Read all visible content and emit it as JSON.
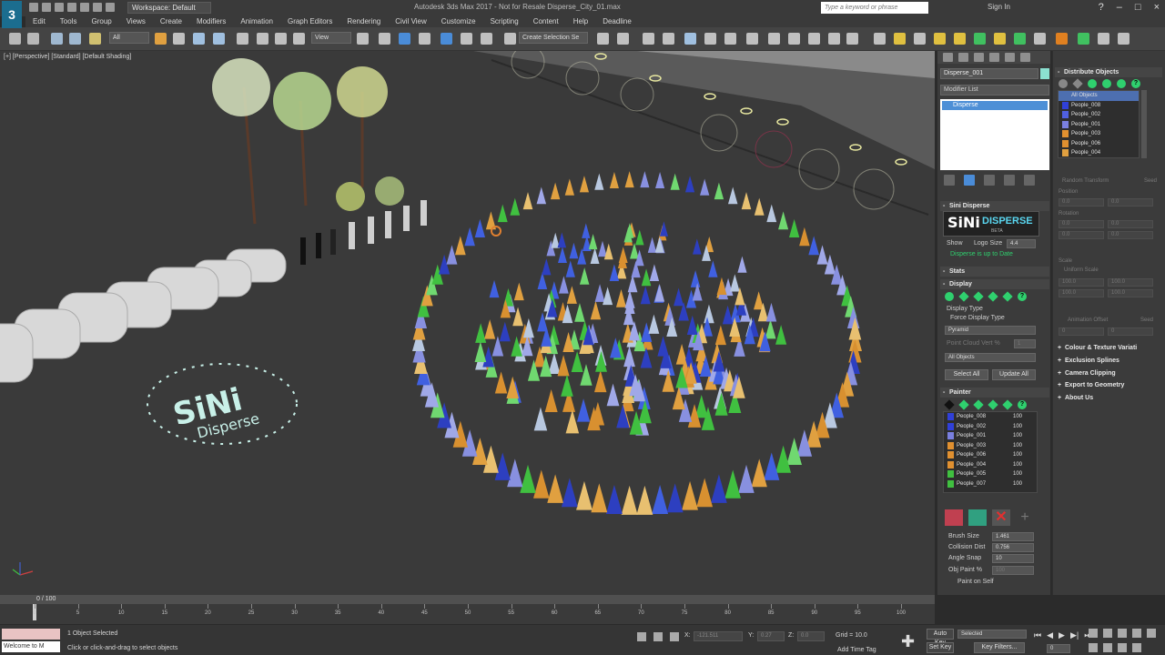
{
  "app": {
    "logo_letter": "3",
    "workspace": "Workspace: Default",
    "window_title": "Autodesk 3ds Max 2017 - Not for Resale   Disperse_City_01.max",
    "search_placeholder": "Type a keyword or phrase",
    "sign_in": "Sign In",
    "help_icon": "?"
  },
  "menu": [
    "Edit",
    "Tools",
    "Group",
    "Views",
    "Create",
    "Modifiers",
    "Animation",
    "Graph Editors",
    "Rendering",
    "Civil View",
    "Customize",
    "Scripting",
    "Content",
    "Help",
    "Deadline"
  ],
  "toolbar": {
    "filter": "All",
    "ref_coord": "View",
    "selection_set": "Create Selection Se"
  },
  "viewport": {
    "label": "[+] [Perspective] [Standard] [Default Shading]",
    "logo_text_1": "SiNi",
    "logo_text_2": "Disperse"
  },
  "command_panel": {
    "object_name": "Disperse_001",
    "object_color": "#8be0d0",
    "modifier_list": "Modifier List",
    "stack_item": "Disperse",
    "rollouts": {
      "sini_disperse": "Sini Disperse",
      "stats": "Stats",
      "display": "Display",
      "painter": "Painter"
    },
    "logo": {
      "sini": "SiNi",
      "disperse": "DISPERSE",
      "beta": "BETA"
    },
    "show_label": "Show",
    "logo_size_label": "Logo Size",
    "logo_size_value": "4.4",
    "update_text": "Disperse is up to Date",
    "display_type_label": "Display Type",
    "force_display_type": "Force Display Type",
    "display_type_value": "Pyramid",
    "point_cloud_label": "Point Cloud Vert %",
    "point_cloud_value": "1",
    "objects_filter": "All Objects",
    "select_all": "Select All",
    "update_all": "Update All",
    "painter_items": [
      {
        "name": "People_008",
        "value": "100",
        "color": "#3040d8"
      },
      {
        "name": "People_002",
        "value": "100",
        "color": "#3040d8"
      },
      {
        "name": "People_001",
        "value": "100",
        "color": "#7a80e0"
      },
      {
        "name": "People_003",
        "value": "100",
        "color": "#e09030"
      },
      {
        "name": "People_006",
        "value": "100",
        "color": "#e09030"
      },
      {
        "name": "People_004",
        "value": "100",
        "color": "#e09030"
      },
      {
        "name": "People_005",
        "value": "100",
        "color": "#40c040"
      },
      {
        "name": "People_007",
        "value": "100",
        "color": "#40c040"
      }
    ],
    "brush_size_label": "Brush Size",
    "brush_size_value": "1.461",
    "collision_label": "Collision Dist",
    "collision_value": "0.756",
    "angle_snap_label": "Angle Snap",
    "angle_snap_value": "10",
    "obj_paint_label": "Obj Paint %",
    "obj_paint_value": "100",
    "paint_on_self": "Paint on Self"
  },
  "distribute_panel": {
    "title": "Distribute Objects",
    "items": [
      {
        "name": "All Objects",
        "color": "#4d6fb0",
        "selected": true
      },
      {
        "name": "People_008",
        "color": "#3040d8",
        "selected": false
      },
      {
        "name": "People_002",
        "color": "#5060e0",
        "selected": false
      },
      {
        "name": "People_001",
        "color": "#7a80e0",
        "selected": false
      },
      {
        "name": "People_003",
        "color": "#e09030",
        "selected": false
      },
      {
        "name": "People_006",
        "color": "#e09030",
        "selected": false
      },
      {
        "name": "People_004",
        "color": "#e0a040",
        "selected": false
      }
    ],
    "random_transform": "Random Transform",
    "seed": "Seed",
    "position": "Position",
    "rotation": "Rotation",
    "scale": "Scale",
    "uniform_scale": "Uniform Scale",
    "animation_offset": "Animation Offset",
    "zero": "0.0",
    "hundred": "100.0",
    "zero_int": "0",
    "rollouts": [
      "Colour & Texture Variati",
      "Exclusion Splines",
      "Camera Clipping",
      "Export to Geometry",
      "About Us"
    ]
  },
  "timeline": {
    "frame": "0 / 100",
    "ticks": [
      "0",
      "5",
      "10",
      "15",
      "20",
      "25",
      "30",
      "35",
      "40",
      "45",
      "50",
      "55",
      "60",
      "65",
      "70",
      "75",
      "80",
      "85",
      "90",
      "95",
      "100"
    ]
  },
  "status": {
    "maxscript_1": "",
    "maxscript_2": "Welcome to M",
    "selected": "1 Object Selected",
    "prompt": "Click or click-and-drag to select objects",
    "x_label": "X:",
    "x_value": "-121.511",
    "y_label": "Y:",
    "y_value": "0.27",
    "z_label": "Z:",
    "z_value": "0.0",
    "grid": "Grid = 10.0",
    "add_time_tag": "Add Time Tag",
    "auto_key": "Auto Key",
    "selected_dropdown": "Selected",
    "set_key": "Set Key",
    "key_filters": "Key Filters...",
    "frame_field": "0"
  },
  "colors": {
    "accent_blue": "#4d8fd6",
    "disperse_green": "#2fd06e"
  }
}
